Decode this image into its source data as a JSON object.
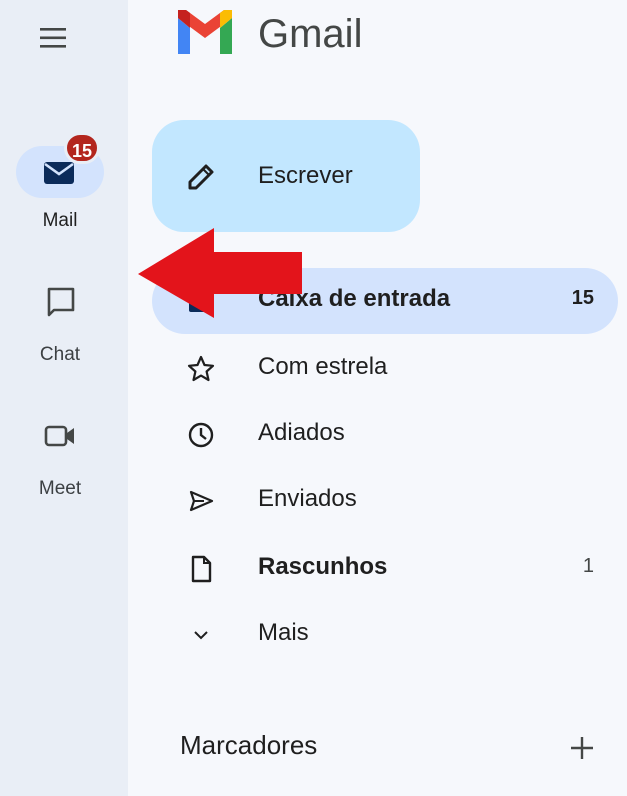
{
  "app": {
    "title": "Gmail",
    "logo_icon": "gmail-m-logo-icon"
  },
  "rail": {
    "menu_icon": "hamburger-menu-icon",
    "items": [
      {
        "label": "Mail",
        "icon": "mail-envelope-icon",
        "badge": "15",
        "active": true
      },
      {
        "label": "Chat",
        "icon": "chat-bubble-icon",
        "active": false
      },
      {
        "label": "Meet",
        "icon": "video-camera-icon",
        "active": false
      }
    ]
  },
  "compose": {
    "label": "Escrever",
    "icon": "pencil-icon",
    "color": "#c2e7ff"
  },
  "nav": {
    "items": [
      {
        "label": "Caixa de entrada",
        "icon": "inbox-icon",
        "count": "15",
        "active": true,
        "bold": true
      },
      {
        "label": "Com estrela",
        "icon": "star-icon",
        "count": "",
        "active": false,
        "bold": false
      },
      {
        "label": "Adiados",
        "icon": "clock-icon",
        "count": "",
        "active": false,
        "bold": false
      },
      {
        "label": "Enviados",
        "icon": "send-icon",
        "count": "",
        "active": false,
        "bold": false
      },
      {
        "label": "Rascunhos",
        "icon": "draft-file-icon",
        "count": "1",
        "active": false,
        "bold": true
      },
      {
        "label": "Mais",
        "icon": "chevron-down-icon",
        "count": "",
        "active": false,
        "bold": false
      }
    ]
  },
  "labels_section": {
    "title": "Marcadores",
    "add_icon": "plus-icon"
  },
  "annotation": {
    "icon": "red-arrow-icon",
    "color": "#e3141b"
  },
  "colors": {
    "rail_bg": "#e9eef6",
    "page_bg": "#f6f8fc",
    "active_bg": "#d3e3fd",
    "badge_bg": "#b3261e"
  }
}
